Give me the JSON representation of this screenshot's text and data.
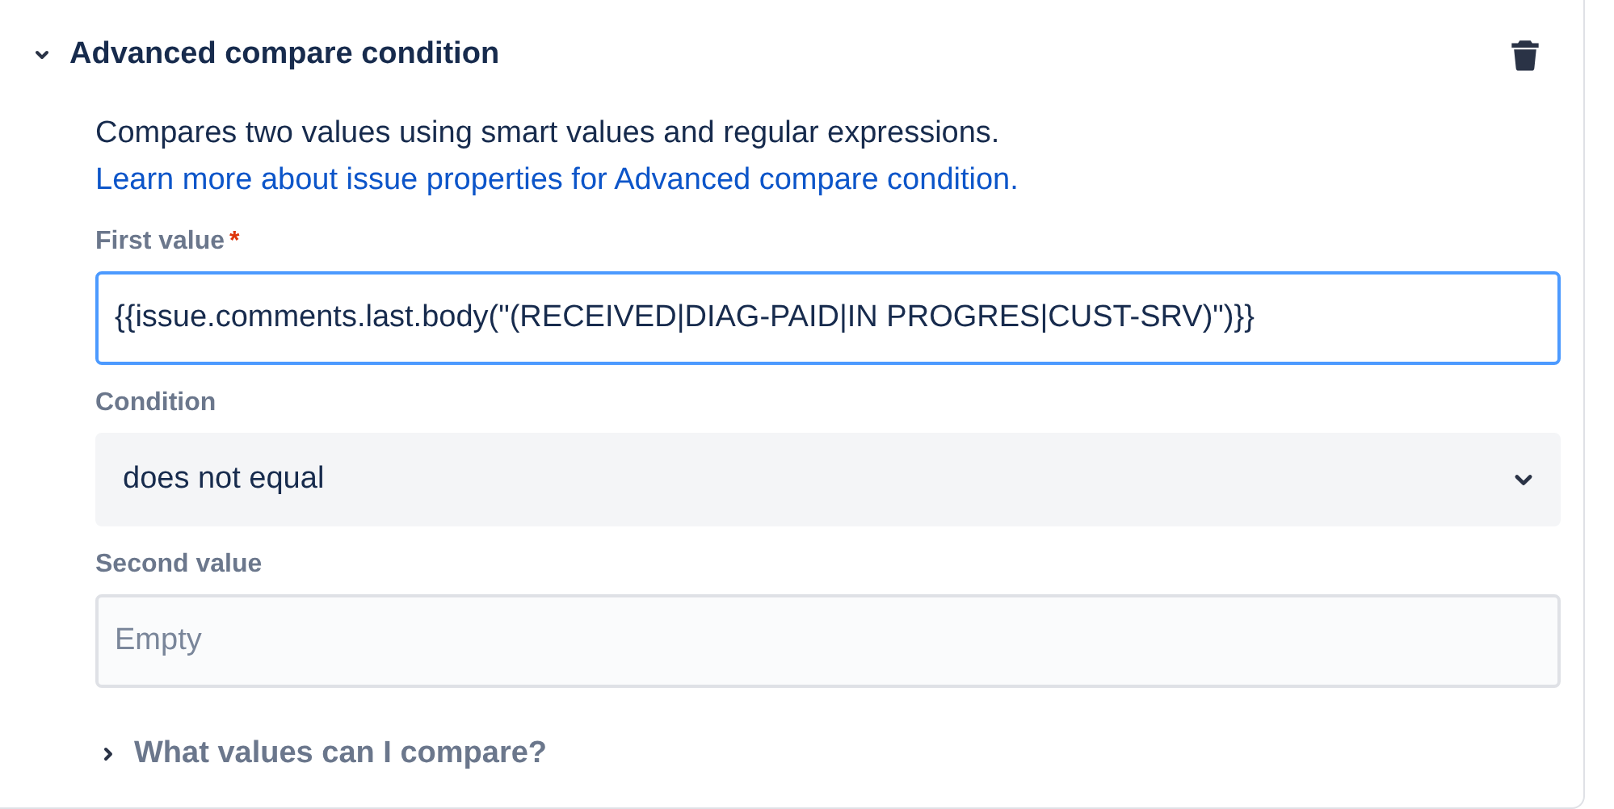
{
  "panel": {
    "title": "Advanced compare condition",
    "expanded": true,
    "description": "Compares two values using smart values and regular expressions.",
    "link": "Learn more about issue properties for Advanced compare condition.",
    "fields": [
      {
        "kind": "text",
        "label": "First value",
        "required_mark": "*",
        "value": "{{issue.comments.last.body(\"(RECEIVED|DIAG-PAID|IN PROGRES|CUST-SRV)\")}}",
        "focused": true
      },
      {
        "kind": "select",
        "label": "Condition",
        "value": "does not equal",
        "focused": false
      },
      {
        "kind": "text",
        "label": "Second value",
        "placeholder": "Empty",
        "focused": false
      }
    ],
    "help": {
      "label": "What values can I compare?",
      "expanded": false
    }
  }
}
